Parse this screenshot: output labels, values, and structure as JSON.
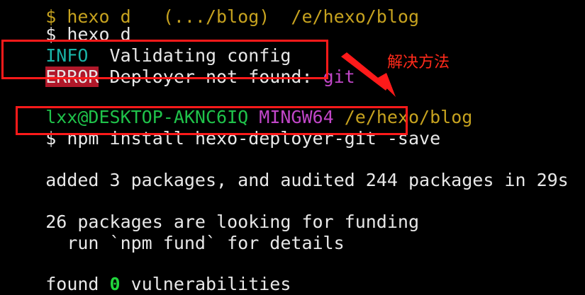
{
  "terminal": {
    "line0": {
      "text": "$ hexo d   (.../blog)  /e/hexo/blog"
    },
    "line1": {
      "prompt": "$ ",
      "command": "hexo d"
    },
    "line2": {
      "level": "INFO",
      "message": "  Validating config"
    },
    "line3": {
      "level": "ERROR",
      "message": " Deployer not found: ",
      "target": "git"
    },
    "line5": {
      "user_host": "lxx@DESKTOP-AKNC6IQ",
      "shell": "MINGW64",
      "path": "/e/hexo/blog"
    },
    "line6": {
      "prompt": "$ ",
      "command": "npm install hexo-deployer-git -save"
    },
    "line8": {
      "text": "added 3 packages, and audited 244 packages in 29s"
    },
    "line10": {
      "text": "26 packages are looking for funding"
    },
    "line11": {
      "text": "  run `npm fund` for details"
    },
    "line13": {
      "prefix": "found ",
      "count": "0",
      "suffix": " vulnerabilities"
    }
  },
  "annotation": {
    "label": "解决方法",
    "color": "#ff2a1a"
  },
  "colors": {
    "background": "#000000",
    "text": "#e8e8e8",
    "info": "#19b3a6",
    "error_badge": "#b0182a",
    "user_host": "#1fc24a",
    "shell": "#c146c8",
    "path": "#c6a21f",
    "highlight_box": "#ff1a1a"
  }
}
